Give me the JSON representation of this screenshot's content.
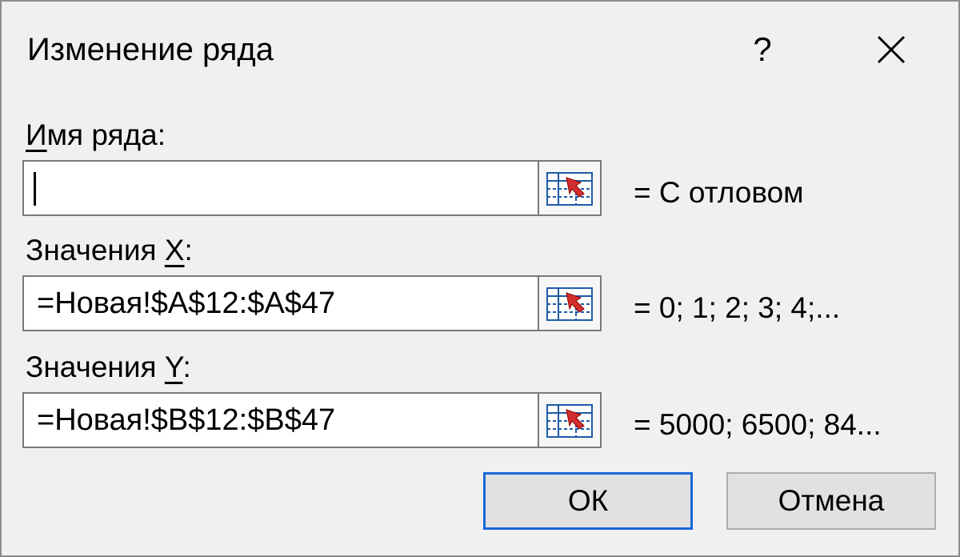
{
  "dialog": {
    "title": "Изменение ряда",
    "help_label": "?",
    "close_icon": "close-icon"
  },
  "series_name": {
    "label_accel": "И",
    "label_rest": "мя ряда:",
    "value": "",
    "preview": "= С отловом"
  },
  "x_values": {
    "label_before": "Значения ",
    "label_accel": "X",
    "label_after": ":",
    "value": "=Новая!$A$12:$A$47",
    "preview": "= 0; 1; 2; 3; 4;..."
  },
  "y_values": {
    "label_before": "Значения ",
    "label_accel": "Y",
    "label_after": ":",
    "value": "=Новая!$B$12:$B$47",
    "preview": "= 5000; 6500; 84..."
  },
  "buttons": {
    "ok": "ОК",
    "cancel": "Отмена"
  },
  "icons": {
    "range_select": "range-select-icon"
  },
  "colors": {
    "accent": "#1666d6",
    "ref_arrow": "#d32f2f",
    "ref_grid": "#1e5aa8"
  }
}
